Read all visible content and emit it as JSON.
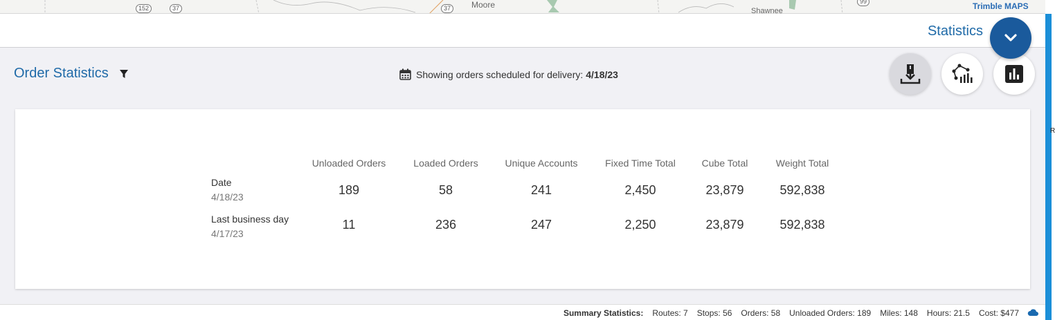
{
  "map": {
    "shields": [
      "152",
      "37",
      "37",
      "99"
    ],
    "labels": [
      "Moore",
      "Shawnee"
    ],
    "logo": "Trimble MAPS"
  },
  "header": {
    "title": "Statistics"
  },
  "order_stats": {
    "title": "Order Statistics",
    "delivery_prefix": "Showing orders scheduled for delivery:",
    "delivery_date": "4/18/23",
    "columns": [
      "Unloaded Orders",
      "Loaded Orders",
      "Unique Accounts",
      "Fixed Time Total",
      "Cube Total",
      "Weight Total"
    ],
    "rows": [
      {
        "label": "Date",
        "sub": "4/18/23",
        "values": [
          "189",
          "58",
          "241",
          "2,450",
          "23,879",
          "592,838"
        ]
      },
      {
        "label": "Last business day",
        "sub": "4/17/23",
        "values": [
          "11",
          "236",
          "247",
          "2,250",
          "23,879",
          "592,838"
        ]
      }
    ]
  },
  "summary": {
    "label": "Summary Statistics:",
    "routes": "Routes: 7",
    "stops": "Stops: 56",
    "orders": "Orders: 58",
    "unloaded": "Unloaded Orders: 189",
    "miles": "Miles: 148",
    "hours": "Hours: 21.5",
    "cost": "Cost: $477"
  },
  "edge_char": "R",
  "colors": {
    "accent": "#1f6aa8",
    "fab": "#1a5a9c",
    "edge": "#1b8fd8"
  }
}
